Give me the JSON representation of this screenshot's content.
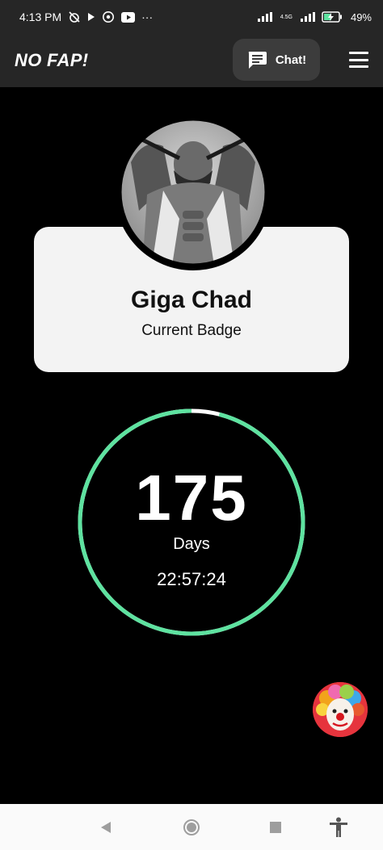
{
  "status_bar": {
    "time": "4:13 PM",
    "dots": "···",
    "network_top": "4.5G",
    "battery_percent": "49%",
    "icons": [
      "mute-alarm-icon",
      "play-icon",
      "whatsapp-icon",
      "youtube-icon",
      "signal-icon",
      "signal-icon",
      "battery-charging-icon"
    ]
  },
  "app_bar": {
    "title": "NO FAP!",
    "chat_label": "Chat!",
    "chat_icon": "chat-icon",
    "menu_icon": "hamburger-menu-icon"
  },
  "profile": {
    "name": "Giga Chad",
    "badge": "Current Badge"
  },
  "streak": {
    "days": "175",
    "days_label": "Days",
    "time": "22:57:24",
    "progress": 0.96,
    "ring_color": "#5ee2a0",
    "track_color": "#ffffff"
  },
  "nav_bar": {
    "icons": [
      "back-icon",
      "home-icon",
      "recents-icon",
      "accessibility-icon"
    ]
  },
  "colors": {
    "background": "#000000",
    "bar": "#262626",
    "card": "#f3f3f3",
    "accent": "#5ee2a0",
    "fab": "#e6343d"
  }
}
